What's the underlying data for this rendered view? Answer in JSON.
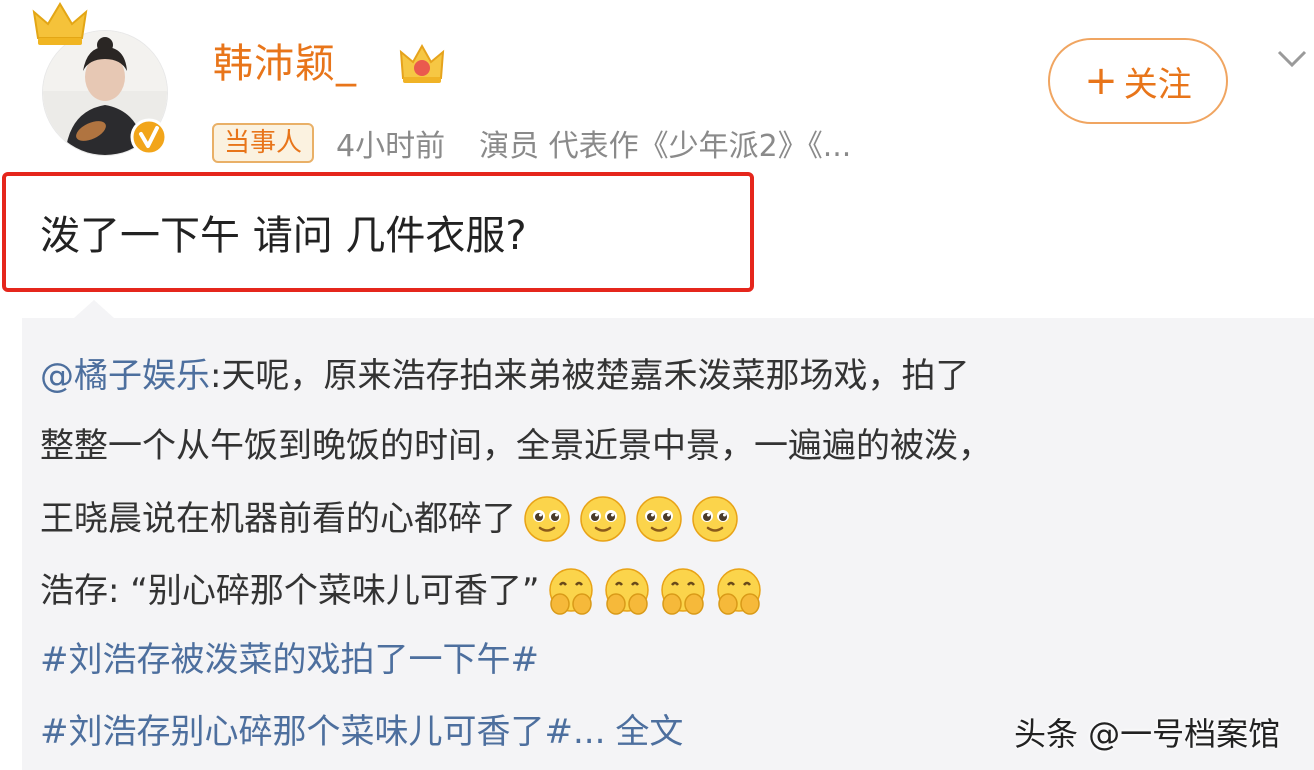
{
  "user": {
    "name": "韩沛颖_",
    "badge": "当事人",
    "time": "4小时前",
    "description": "演员 代表作《少年派2》《..."
  },
  "follow": {
    "plus": "+",
    "label": "关注"
  },
  "post": {
    "text": "泼了一下午 请问 几件衣服?"
  },
  "repost": {
    "mention": "@橘子娱乐",
    "line1_rest": " :天呢，原来浩存拍来弟被楚嘉禾泼菜那场戏，拍了",
    "line2": "整整一个从午饭到晚饭的时间，全景近景中景，一遍遍的被泼，",
    "line3": "王晓晨说在机器前看的心都碎了",
    "line4": "浩存: “别心碎那个菜味儿可香了”",
    "hashtag1": "#刘浩存被泼菜的戏拍了一下午#",
    "hashtag2": "#刘浩存别心碎那个菜味儿可香了#...",
    "read_more": "全文"
  },
  "emoji_names": [
    "teary-smile-emoji",
    "covering-face-emoji"
  ],
  "watermark": "头条 @一号档案馆",
  "colors": {
    "username": "#e8751a",
    "follow_border": "#f0a561",
    "highlight_border": "#e5261c",
    "link": "#4d6f9e",
    "repost_bg": "#f4f4f6",
    "meta": "#8a8a8a"
  }
}
